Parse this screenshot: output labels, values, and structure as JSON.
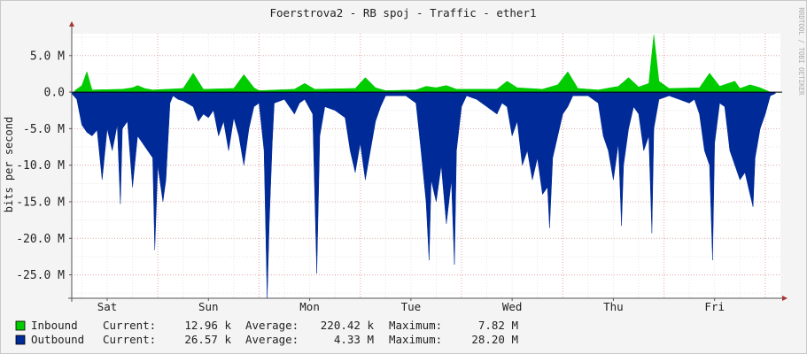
{
  "chart_data": {
    "type": "area",
    "title": "Foerstrova2 - RB spoj - Traffic - ether1",
    "ylabel": "bits per second",
    "watermark": "RRDTOOL / TOBI OETIKER",
    "ylim": [
      -28.2,
      8.0
    ],
    "y_ticks": [
      {
        "value": 5,
        "label": "5.0 M"
      },
      {
        "value": 0,
        "label": "0.0"
      },
      {
        "value": -5,
        "label": "-5.0 M"
      },
      {
        "value": -10,
        "label": "-10.0 M"
      },
      {
        "value": -15,
        "label": "-15.0 M"
      },
      {
        "value": -20,
        "label": "-20.0 M"
      },
      {
        "value": -25,
        "label": "-25.0 M"
      }
    ],
    "x_range_days": [
      0,
      7
    ],
    "x_ticks": [
      {
        "pos": 0.35,
        "label": "Sat"
      },
      {
        "pos": 1.35,
        "label": "Sun"
      },
      {
        "pos": 2.35,
        "label": "Mon"
      },
      {
        "pos": 3.35,
        "label": "Tue"
      },
      {
        "pos": 4.35,
        "label": "Wed"
      },
      {
        "pos": 5.35,
        "label": "Thu"
      },
      {
        "pos": 6.35,
        "label": "Fri"
      }
    ],
    "grid": true,
    "series": [
      {
        "name": "Inbound",
        "color": "#00cc00",
        "current": "12.96 k",
        "average": "220.42 k",
        "maximum": "7.82 M",
        "points": [
          [
            0.03,
            0.2
          ],
          [
            0.1,
            0.9
          ],
          [
            0.15,
            2.8
          ],
          [
            0.2,
            0.3
          ],
          [
            0.5,
            0.4
          ],
          [
            0.6,
            0.6
          ],
          [
            0.65,
            0.9
          ],
          [
            0.72,
            0.5
          ],
          [
            0.8,
            0.3
          ],
          [
            1.1,
            0.5
          ],
          [
            1.2,
            2.6
          ],
          [
            1.3,
            0.4
          ],
          [
            1.6,
            0.5
          ],
          [
            1.7,
            2.4
          ],
          [
            1.8,
            0.6
          ],
          [
            1.85,
            0.2
          ],
          [
            2.2,
            0.4
          ],
          [
            2.3,
            1.2
          ],
          [
            2.4,
            0.4
          ],
          [
            2.8,
            0.5
          ],
          [
            2.9,
            2.0
          ],
          [
            3.0,
            0.6
          ],
          [
            3.1,
            0.2
          ],
          [
            3.4,
            0.3
          ],
          [
            3.5,
            0.8
          ],
          [
            3.6,
            0.6
          ],
          [
            3.7,
            0.9
          ],
          [
            3.8,
            0.4
          ],
          [
            4.2,
            0.4
          ],
          [
            4.3,
            1.5
          ],
          [
            4.4,
            0.6
          ],
          [
            4.65,
            0.4
          ],
          [
            4.8,
            1.0
          ],
          [
            4.9,
            2.8
          ],
          [
            5.0,
            0.5
          ],
          [
            5.2,
            0.3
          ],
          [
            5.4,
            0.8
          ],
          [
            5.5,
            2.0
          ],
          [
            5.6,
            0.7
          ],
          [
            5.7,
            1.2
          ],
          [
            5.75,
            7.82
          ],
          [
            5.8,
            1.5
          ],
          [
            5.9,
            0.5
          ],
          [
            6.2,
            0.6
          ],
          [
            6.3,
            2.6
          ],
          [
            6.4,
            0.8
          ],
          [
            6.55,
            1.5
          ],
          [
            6.6,
            0.5
          ],
          [
            6.7,
            1.0
          ],
          [
            6.8,
            0.6
          ],
          [
            6.9,
            0.0
          ]
        ]
      },
      {
        "name": "Outbound",
        "color": "#002a97",
        "current": "26.57 k",
        "average": "4.33 M",
        "maximum": "28.20 M",
        "points": [
          [
            0.0,
            -0.2
          ],
          [
            0.05,
            -1.0
          ],
          [
            0.1,
            -4.5
          ],
          [
            0.15,
            -5.5
          ],
          [
            0.2,
            -6.0
          ],
          [
            0.25,
            -5.2
          ],
          [
            0.3,
            -12.0
          ],
          [
            0.35,
            -5.0
          ],
          [
            0.4,
            -8.0
          ],
          [
            0.45,
            -4.5
          ],
          [
            0.48,
            -15.3
          ],
          [
            0.5,
            -5.0
          ],
          [
            0.55,
            -4.0
          ],
          [
            0.6,
            -13.0
          ],
          [
            0.65,
            -6.0
          ],
          [
            0.7,
            -7.0
          ],
          [
            0.75,
            -8.0
          ],
          [
            0.8,
            -9.0
          ],
          [
            0.82,
            -21.6
          ],
          [
            0.85,
            -10.0
          ],
          [
            0.9,
            -15.0
          ],
          [
            0.93,
            -12.0
          ],
          [
            0.97,
            -1.5
          ],
          [
            1.0,
            -0.5
          ],
          [
            1.05,
            -1.0
          ],
          [
            1.1,
            -1.2
          ],
          [
            1.2,
            -2.0
          ],
          [
            1.25,
            -4.0
          ],
          [
            1.3,
            -3.0
          ],
          [
            1.35,
            -3.5
          ],
          [
            1.4,
            -2.5
          ],
          [
            1.45,
            -6.0
          ],
          [
            1.5,
            -4.0
          ],
          [
            1.55,
            -8.0
          ],
          [
            1.6,
            -3.5
          ],
          [
            1.65,
            -6.0
          ],
          [
            1.7,
            -10.0
          ],
          [
            1.75,
            -5.0
          ],
          [
            1.8,
            -2.0
          ],
          [
            1.85,
            -1.5
          ],
          [
            1.9,
            -8.0
          ],
          [
            1.93,
            -28.2
          ],
          [
            1.95,
            -18.0
          ],
          [
            1.98,
            -7.0
          ],
          [
            2.0,
            -1.5
          ],
          [
            2.1,
            -1.0
          ],
          [
            2.15,
            -2.0
          ],
          [
            2.2,
            -3.0
          ],
          [
            2.25,
            -1.5
          ],
          [
            2.3,
            -1.0
          ],
          [
            2.38,
            -3.0
          ],
          [
            2.42,
            -24.8
          ],
          [
            2.45,
            -6.0
          ],
          [
            2.5,
            -2.0
          ],
          [
            2.6,
            -2.5
          ],
          [
            2.7,
            -3.5
          ],
          [
            2.75,
            -8.0
          ],
          [
            2.8,
            -11.0
          ],
          [
            2.85,
            -7.0
          ],
          [
            2.9,
            -12.0
          ],
          [
            2.95,
            -8.0
          ],
          [
            3.0,
            -4.0
          ],
          [
            3.05,
            -2.0
          ],
          [
            3.1,
            -0.5
          ],
          [
            3.3,
            -0.5
          ],
          [
            3.4,
            -1.5
          ],
          [
            3.45,
            -8.0
          ],
          [
            3.5,
            -15.0
          ],
          [
            3.53,
            -23.0
          ],
          [
            3.55,
            -12.0
          ],
          [
            3.6,
            -15.0
          ],
          [
            3.65,
            -10.0
          ],
          [
            3.7,
            -18.0
          ],
          [
            3.75,
            -12.0
          ],
          [
            3.78,
            -23.6
          ],
          [
            3.8,
            -8.0
          ],
          [
            3.85,
            -2.0
          ],
          [
            3.9,
            -0.5
          ],
          [
            4.0,
            -1.0
          ],
          [
            4.1,
            -2.0
          ],
          [
            4.2,
            -3.0
          ],
          [
            4.25,
            -1.5
          ],
          [
            4.3,
            -2.0
          ],
          [
            4.35,
            -6.0
          ],
          [
            4.4,
            -4.0
          ],
          [
            4.45,
            -10.0
          ],
          [
            4.5,
            -8.0
          ],
          [
            4.55,
            -12.0
          ],
          [
            4.6,
            -9.0
          ],
          [
            4.65,
            -14.0
          ],
          [
            4.7,
            -13.0
          ],
          [
            4.72,
            -18.6
          ],
          [
            4.75,
            -9.0
          ],
          [
            4.8,
            -6.0
          ],
          [
            4.85,
            -3.0
          ],
          [
            4.9,
            -2.0
          ],
          [
            4.95,
            -0.5
          ],
          [
            5.1,
            -0.5
          ],
          [
            5.2,
            -1.5
          ],
          [
            5.25,
            -6.0
          ],
          [
            5.3,
            -8.0
          ],
          [
            5.35,
            -12.0
          ],
          [
            5.4,
            -7.0
          ],
          [
            5.43,
            -18.3
          ],
          [
            5.45,
            -10.0
          ],
          [
            5.5,
            -5.0
          ],
          [
            5.55,
            -2.0
          ],
          [
            5.6,
            -3.0
          ],
          [
            5.65,
            -8.0
          ],
          [
            5.7,
            -6.0
          ],
          [
            5.73,
            -19.3
          ],
          [
            5.75,
            -5.0
          ],
          [
            5.8,
            -1.0
          ],
          [
            5.9,
            -0.5
          ],
          [
            6.0,
            -1.0
          ],
          [
            6.1,
            -1.5
          ],
          [
            6.15,
            -1.0
          ],
          [
            6.2,
            -3.0
          ],
          [
            6.25,
            -8.0
          ],
          [
            6.3,
            -10.0
          ],
          [
            6.33,
            -23.0
          ],
          [
            6.35,
            -7.0
          ],
          [
            6.4,
            -1.5
          ],
          [
            6.45,
            -2.0
          ],
          [
            6.5,
            -8.0
          ],
          [
            6.55,
            -10.0
          ],
          [
            6.6,
            -12.0
          ],
          [
            6.65,
            -11.0
          ],
          [
            6.7,
            -14.0
          ],
          [
            6.73,
            -15.7
          ],
          [
            6.75,
            -9.0
          ],
          [
            6.8,
            -5.0
          ],
          [
            6.85,
            -3.0
          ],
          [
            6.9,
            -0.5
          ],
          [
            6.95,
            -0.2
          ]
        ]
      }
    ]
  },
  "legend": {
    "current_label": "Current:",
    "average_label": "Average:",
    "maximum_label": "Maximum:"
  }
}
